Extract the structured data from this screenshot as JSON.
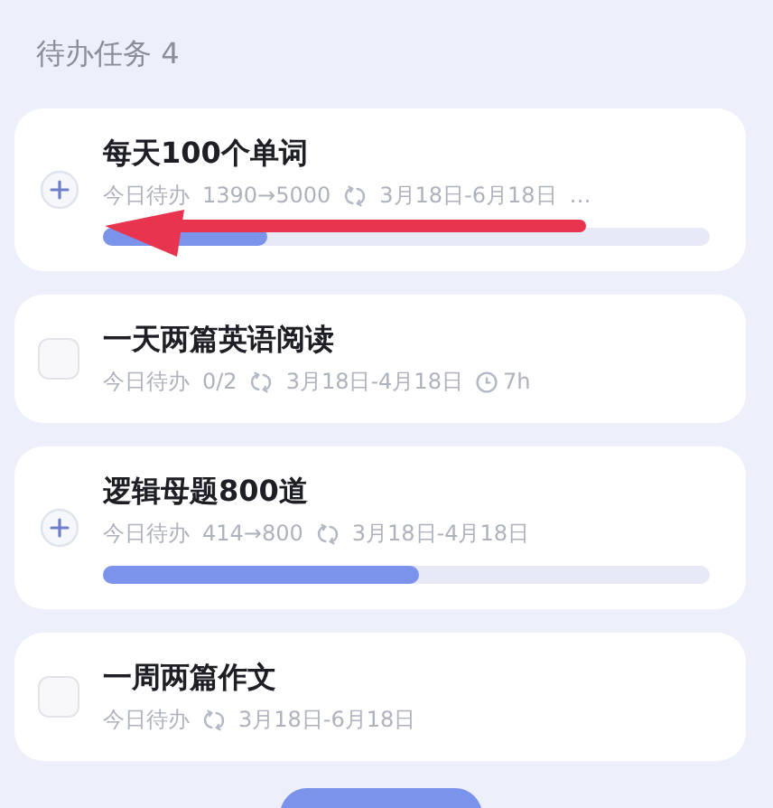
{
  "section": {
    "title": "待办任务 4"
  },
  "tasks": [
    {
      "kind": "progress",
      "title": "每天100个单词",
      "status": "今日待办",
      "count": "1390→5000",
      "dates": "3月18日-6月18日",
      "more": "…",
      "level": 0.27
    },
    {
      "kind": "check",
      "title": "一天两篇英语阅读",
      "status": "今日待办",
      "count": "0/2",
      "dates": "3月18日-4月18日",
      "duration": "7h",
      "checked": false
    },
    {
      "kind": "progress",
      "title": "逻辑母题800道",
      "status": "今日待办",
      "count": "414→800",
      "dates": "3月18日-4月18日",
      "level": 0.52
    },
    {
      "kind": "check",
      "title": "一周两篇作文",
      "status": "今日待办",
      "dates": "3月18日-6月18日",
      "checked": false
    }
  ]
}
